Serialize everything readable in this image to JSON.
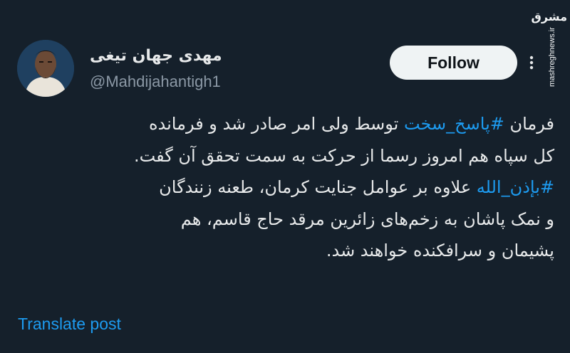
{
  "tweet": {
    "display_name": "مهدی جهان تیغی",
    "handle": "@Mahdijahantigh1",
    "follow_label": "Follow",
    "more_icon": "ellipsis-icon",
    "lines": [
      {
        "pre": "فرمان ",
        "tag": "#پاسخ_سخت",
        "post": " توسط ولی امر صادر شد و فرمانده"
      },
      {
        "pre": "",
        "tag": "",
        "post": "کل سپاه هم امروز رسما از حرکت به سمت تحقق آن گفت."
      },
      {
        "pre": "",
        "tag": "#بإذن_الله",
        "post": " علاوه بر عوامل جنایت کرمان، طعنه زنندگان"
      },
      {
        "pre": "",
        "tag": "",
        "post": "و نمک پاشان به زخم‌های زائرین مرقد حاج قاسم، هم"
      },
      {
        "pre": "",
        "tag": "",
        "post": "پشیمان و سرافکنده خواهند شد."
      }
    ],
    "translate_label": "Translate post"
  },
  "watermark": {
    "logo_text": "مشرق",
    "site": "mashreghnews.ir"
  },
  "colors": {
    "background": "#15202b",
    "text": "#e7e9ea",
    "secondary": "#8b98a5",
    "link": "#1d9bf0",
    "button_bg": "#eff3f4"
  }
}
